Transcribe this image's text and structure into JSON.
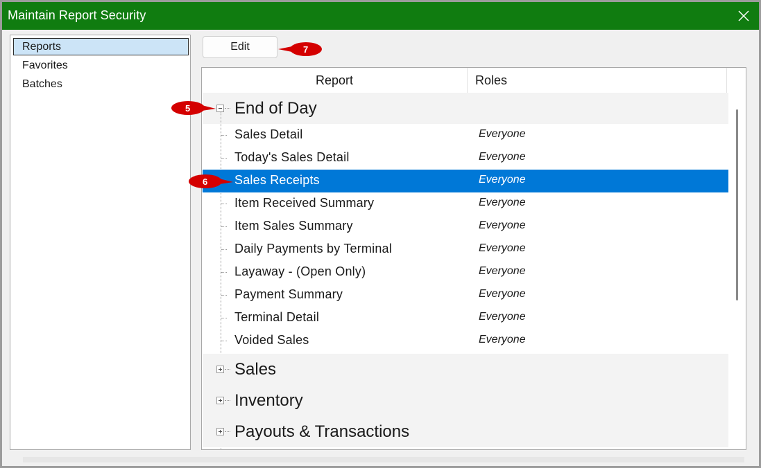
{
  "window": {
    "title": "Maintain Report Security",
    "accent_color": "#107c10",
    "selection_color": "#0078d7",
    "close_icon": "close-icon"
  },
  "nav": {
    "items": [
      {
        "label": "Reports",
        "selected": true
      },
      {
        "label": "Favorites",
        "selected": false
      },
      {
        "label": "Batches",
        "selected": false
      }
    ]
  },
  "toolbar": {
    "edit_label": "Edit"
  },
  "grid": {
    "columns": {
      "report": "Report",
      "roles": "Roles"
    },
    "groups": [
      {
        "title": "End of Day",
        "expanded": true,
        "reports": [
          {
            "name": "Sales Detail",
            "role": "Everyone"
          },
          {
            "name": "Today's Sales Detail",
            "role": "Everyone"
          },
          {
            "name": "Sales Receipts",
            "role": "Everyone",
            "selected": true
          },
          {
            "name": "Item Received Summary",
            "role": "Everyone"
          },
          {
            "name": "Item Sales Summary",
            "role": "Everyone"
          },
          {
            "name": "Daily Payments by Terminal",
            "role": "Everyone"
          },
          {
            "name": "Layaway - (Open Only)",
            "role": "Everyone"
          },
          {
            "name": "Payment Summary",
            "role": "Everyone"
          },
          {
            "name": "Terminal Detail",
            "role": "Everyone"
          },
          {
            "name": "Voided Sales",
            "role": "Everyone"
          }
        ]
      },
      {
        "title": "Sales",
        "expanded": false
      },
      {
        "title": "Inventory",
        "expanded": false
      },
      {
        "title": "Payouts & Transactions",
        "expanded": false
      }
    ]
  },
  "callouts": [
    {
      "number": "5",
      "color": "#d40000"
    },
    {
      "number": "6",
      "color": "#d40000"
    },
    {
      "number": "7",
      "color": "#d40000"
    }
  ]
}
